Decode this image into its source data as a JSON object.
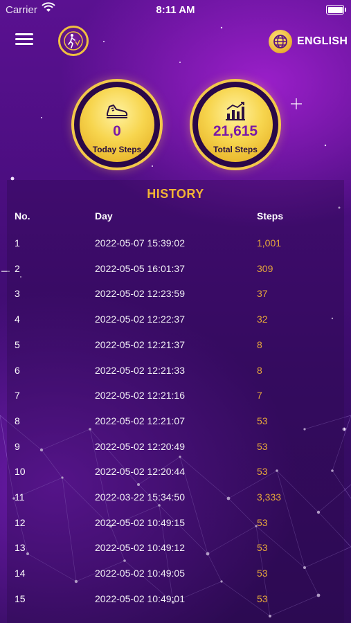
{
  "status_bar": {
    "carrier": "Carrier",
    "time": "8:11 AM"
  },
  "header": {
    "language_label": "ENGLISH"
  },
  "stats": {
    "today": {
      "value": "0",
      "label": "Today Steps",
      "icon": "shoe-icon"
    },
    "total": {
      "value": "21,615",
      "label": "Total Steps",
      "icon": "bar-chart-icon"
    }
  },
  "history": {
    "title": "HISTORY",
    "columns": [
      "No.",
      "Day",
      "Steps"
    ],
    "rows": [
      {
        "no": "1",
        "day": "2022-05-07 15:39:02",
        "steps": "1,001"
      },
      {
        "no": "2",
        "day": "2022-05-05 16:01:37",
        "steps": "309"
      },
      {
        "no": "3",
        "day": "2022-05-02 12:23:59",
        "steps": "37"
      },
      {
        "no": "4",
        "day": "2022-05-02 12:22:37",
        "steps": "32"
      },
      {
        "no": "5",
        "day": "2022-05-02 12:21:37",
        "steps": "8"
      },
      {
        "no": "6",
        "day": "2022-05-02 12:21:33",
        "steps": "8"
      },
      {
        "no": "7",
        "day": "2022-05-02 12:21:16",
        "steps": "7"
      },
      {
        "no": "8",
        "day": "2022-05-02 12:21:07",
        "steps": "53"
      },
      {
        "no": "9",
        "day": "2022-05-02 12:20:49",
        "steps": "53"
      },
      {
        "no": "10",
        "day": "2022-05-02 12:20:44",
        "steps": "53"
      },
      {
        "no": "11",
        "day": "2022-03-22 15:34:50",
        "steps": "3,333"
      },
      {
        "no": "12",
        "day": "2022-05-02 10:49:15",
        "steps": "53"
      },
      {
        "no": "13",
        "day": "2022-05-02 10:49:12",
        "steps": "53"
      },
      {
        "no": "14",
        "day": "2022-05-02 10:49:05",
        "steps": "53"
      },
      {
        "no": "15",
        "day": "2022-05-02 10:49:01",
        "steps": "53"
      }
    ]
  },
  "colors": {
    "accent_gold": "#f2b434",
    "steps_text": "#e7a83a",
    "stat_value": "#7a1aa6"
  }
}
